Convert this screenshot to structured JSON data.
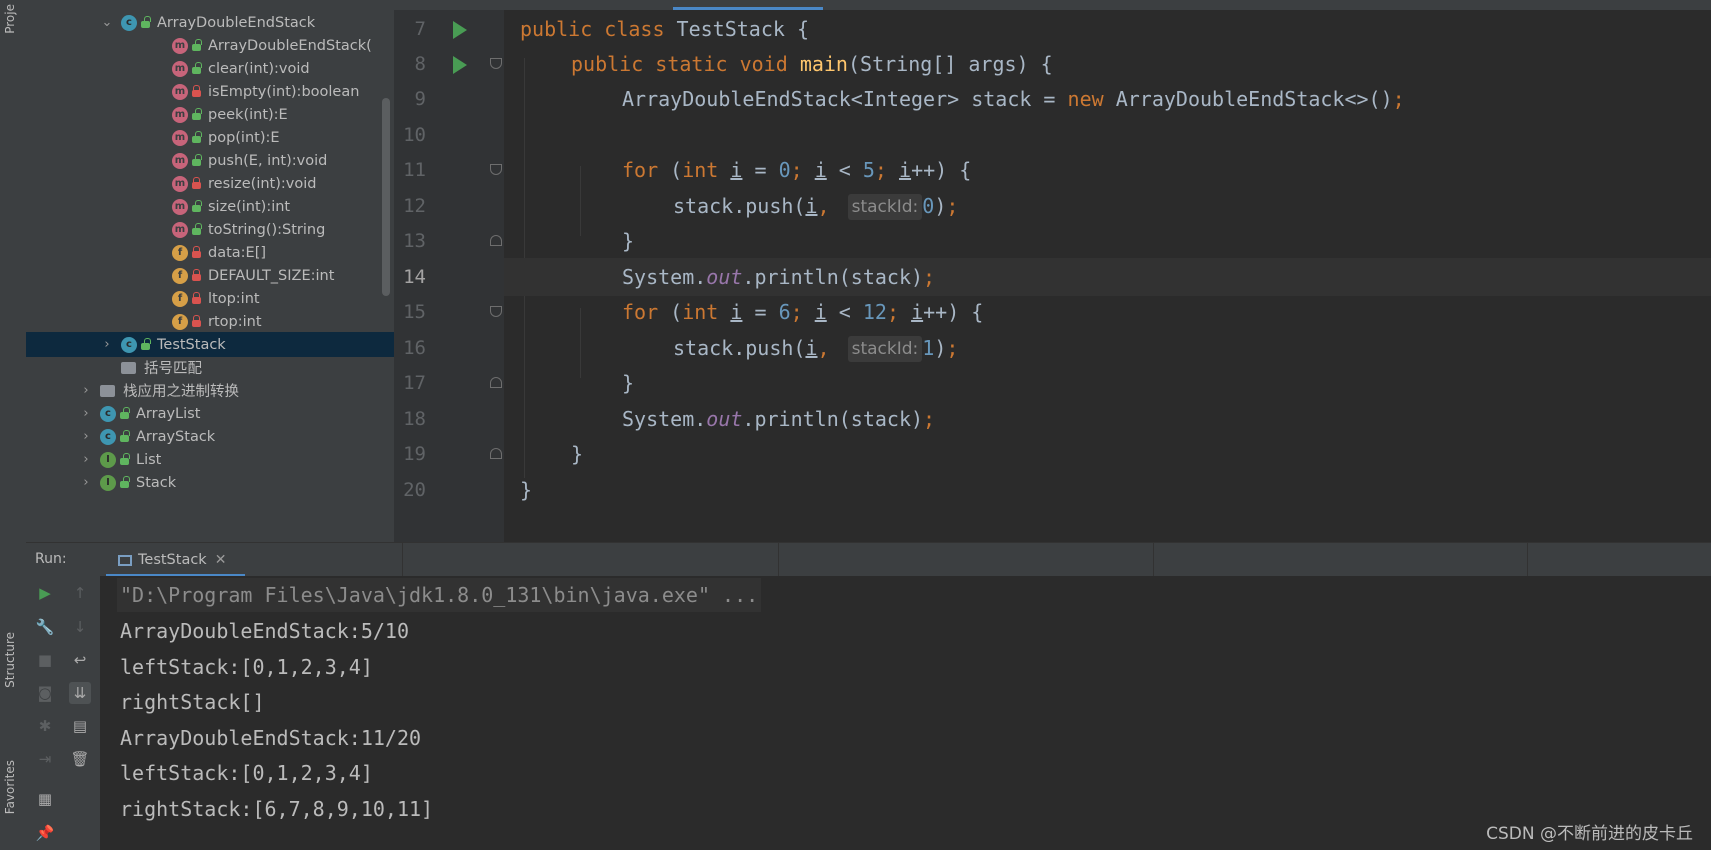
{
  "left_strip": {
    "project_tab": "Proje",
    "structure_tab": "Structure",
    "favorites_tab": "Favorites"
  },
  "project_tree": {
    "items": [
      {
        "label": "ArrayDoubleEndStack",
        "icon": "class-icon",
        "access": "open",
        "expanded": true
      },
      {
        "label": "ArrayDoubleEndStack(",
        "icon": "method-icon",
        "access": "open"
      },
      {
        "label": "clear(int):void",
        "icon": "method-icon",
        "access": "open"
      },
      {
        "label": "isEmpty(int):boolean",
        "icon": "method-icon",
        "access": "lock"
      },
      {
        "label": "peek(int):E",
        "icon": "method-icon",
        "access": "open"
      },
      {
        "label": "pop(int):E",
        "icon": "method-icon",
        "access": "open"
      },
      {
        "label": "push(E, int):void",
        "icon": "method-icon",
        "access": "open"
      },
      {
        "label": "resize(int):void",
        "icon": "method-icon",
        "access": "lock"
      },
      {
        "label": "size(int):int",
        "icon": "method-icon",
        "access": "open"
      },
      {
        "label": "toString():String",
        "icon": "method-icon",
        "access": "open"
      },
      {
        "label": "data:E[]",
        "icon": "field-icon",
        "access": "lock"
      },
      {
        "label": "DEFAULT_SIZE:int",
        "icon": "field-icon",
        "access": "lock"
      },
      {
        "label": "ltop:int",
        "icon": "field-icon",
        "access": "lock"
      },
      {
        "label": "rtop:int",
        "icon": "field-icon",
        "access": "lock"
      },
      {
        "label": "TestStack",
        "icon": "class-icon",
        "access": "open",
        "selected": true
      },
      {
        "label": "括号匹配",
        "icon": "package-icon"
      },
      {
        "label": "栈应用之进制转换",
        "icon": "package-icon"
      },
      {
        "label": "ArrayList",
        "icon": "class-icon",
        "access": "open"
      },
      {
        "label": "ArrayStack",
        "icon": "class-icon",
        "access": "open"
      },
      {
        "label": "List",
        "icon": "interface-icon",
        "access": "open"
      },
      {
        "label": "Stack",
        "icon": "interface-icon",
        "access": "open"
      }
    ]
  },
  "editor": {
    "line_numbers": [
      "7",
      "8",
      "9",
      "10",
      "11",
      "12",
      "13",
      "14",
      "15",
      "16",
      "17",
      "18",
      "19",
      "20"
    ],
    "current_line": "14",
    "code": {
      "l7": {
        "kw1": "public",
        "kw2": "class",
        "rest": " TestStack {"
      },
      "l8": {
        "kw1": "public",
        "kw2": "static",
        "kw3": "void",
        "fn": "main",
        "rest": "(String[] args) {"
      },
      "l9": {
        "a": "ArrayDoubleEndStack<Integer> stack = ",
        "kw": "new",
        "b": " ArrayDoubleEndStack<>()",
        "semi": ";"
      },
      "l11": {
        "kw": "for",
        "a": " (",
        "kw2": "int",
        "v1": "i",
        "eq": " = ",
        "n1": "0",
        "s1": "; ",
        "v2": "i",
        "lt": " < ",
        "n2": "5",
        "s2": "; ",
        "v3": "i",
        "tail": "++) {"
      },
      "l12": {
        "a": "stack.push(",
        "v": "i",
        "comma": ", ",
        "hint": "stackId:",
        "n": "0",
        "close": ")",
        "semi": ";"
      },
      "l13": {
        "a": "}"
      },
      "l14": {
        "a": "System.",
        "st": "out",
        "b": ".println(stack)",
        "semi": ";"
      },
      "l15": {
        "kw": "for",
        "a": " (",
        "kw2": "int",
        "v1": "i",
        "eq": " = ",
        "n1": "6",
        "s1": "; ",
        "v2": "i",
        "lt": " < ",
        "n2": "12",
        "s2": "; ",
        "v3": "i",
        "tail": "++) {"
      },
      "l16": {
        "a": "stack.push(",
        "v": "i",
        "comma": ", ",
        "hint": "stackId:",
        "n": "1",
        "close": ")",
        "semi": ";"
      },
      "l17": {
        "a": "}"
      },
      "l18": {
        "a": "System.",
        "st": "out",
        "b": ".println(stack)",
        "semi": ";"
      },
      "l19": {
        "a": "}"
      },
      "l20": {
        "a": "}"
      }
    }
  },
  "run_panel": {
    "label": "Run:",
    "tab_label": "TestStack",
    "output": [
      "\"D:\\Program Files\\Java\\jdk1.8.0_131\\bin\\java.exe\" ...",
      "ArrayDoubleEndStack:5/10",
      "leftStack:[0,1,2,3,4]",
      "rightStack[]",
      "ArrayDoubleEndStack:11/20",
      "leftStack:[0,1,2,3,4]",
      "rightStack:[6,7,8,9,10,11]"
    ],
    "toolbar_icons": [
      "run-icon",
      "up-arrow-icon",
      "wrench-icon",
      "down-arrow-icon",
      "stop-icon",
      "soft-wrap-icon",
      "camera-icon",
      "scroll-to-end-icon",
      "bug-icon",
      "print-icon",
      "exit-icon",
      "trash-icon",
      "layout-icon",
      "pin-icon"
    ]
  },
  "watermark": "CSDN @不断前进的皮卡丘",
  "colors": {
    "keyword": "#cc7832",
    "number": "#6897bb",
    "function": "#ffc66d",
    "static_field": "#9876aa",
    "text": "#a9b7c6",
    "run_green": "#499c54",
    "selection": "#0d293e"
  }
}
